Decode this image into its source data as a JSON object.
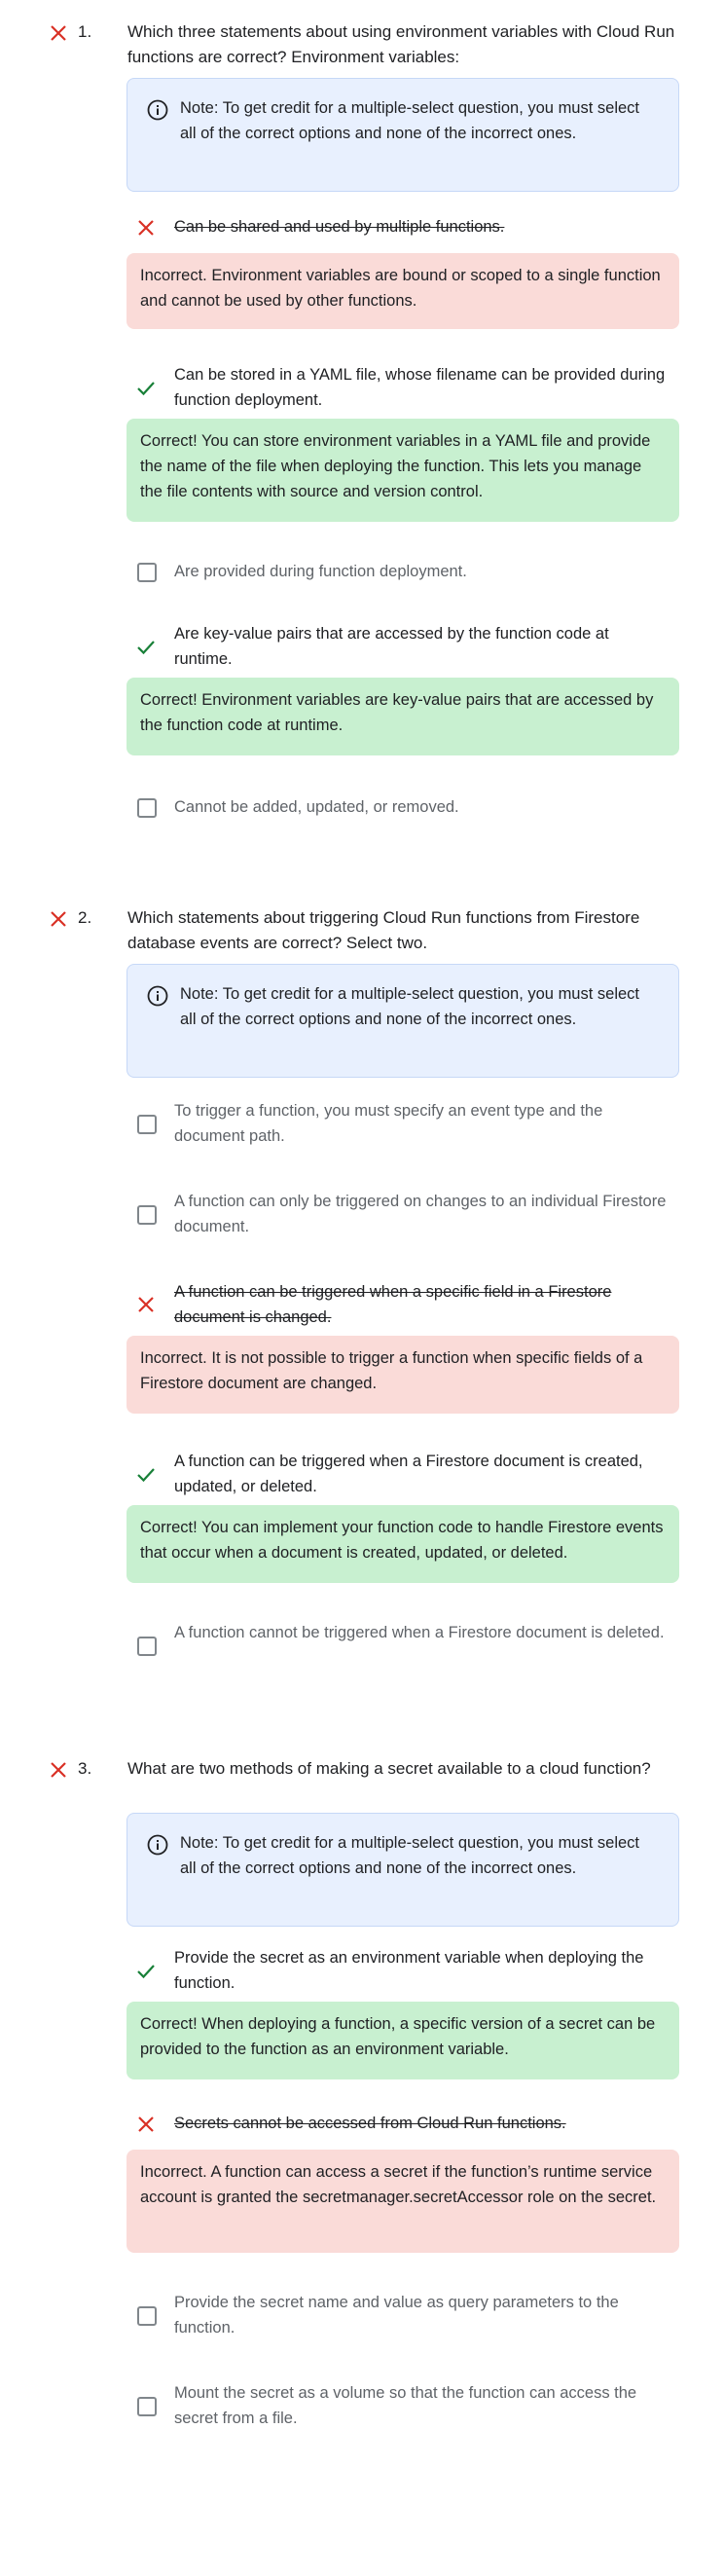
{
  "colors": {
    "incorrect": "#d93025",
    "correct": "#188038",
    "note_bg": "#e8f0fe",
    "bad_bg": "#fadbd8",
    "good_bg": "#c8f0d0"
  },
  "note_text": "Note: To get credit for a multiple-select question, you must select all of the correct options and none of the incorrect ones.",
  "questions": [
    {
      "number": "1.",
      "status_icon": "incorrect-x-icon",
      "text": "Which three statements about using environment variables with Cloud Run functions are correct? Environment variables:",
      "options": [
        {
          "text": "Can be shared and used by multiple functions.",
          "state": "incorrect",
          "feedback": "Incorrect. Environment variables are bound or scoped to a single function and cannot be used by other functions."
        },
        {
          "text": "Can be stored in a YAML file, whose filename can be provided during function deployment.",
          "state": "correct",
          "feedback": "Correct! You can store environment variables in a YAML file and provide the name of the file when deploying the function. This lets you manage the file contents with source and version control."
        },
        {
          "text": "Are provided during function deployment.",
          "state": "unselected"
        },
        {
          "text": "Are key-value pairs that are accessed by the function code at runtime.",
          "state": "correct",
          "feedback": "Correct! Environment variables are key-value pairs that are accessed by the function code at runtime."
        },
        {
          "text": "Cannot be added, updated, or removed.",
          "state": "unselected"
        }
      ]
    },
    {
      "number": "2.",
      "status_icon": "incorrect-x-icon",
      "text": "Which statements about triggering Cloud Run functions from Firestore database events are correct? Select two.",
      "options": [
        {
          "text": "To trigger a function, you must specify an event type and the document path.",
          "state": "unselected"
        },
        {
          "text": "A function can only be triggered on changes to an individual Firestore document.",
          "state": "unselected"
        },
        {
          "text": "A function can be triggered when a specific field in a Firestore document is changed.",
          "state": "incorrect",
          "feedback": "Incorrect. It is not possible to trigger a function when specific fields of a Firestore document are changed."
        },
        {
          "text": "A function can be triggered when a Firestore document is created, updated, or deleted.",
          "state": "correct",
          "feedback": "Correct! You can implement your function code to handle Firestore events that occur when a document is created, updated, or deleted."
        },
        {
          "text": "A function cannot be triggered when a Firestore document is deleted.",
          "state": "unselected"
        }
      ]
    },
    {
      "number": "3.",
      "status_icon": "incorrect-x-icon",
      "text": "What are two methods of making a secret available to a cloud function?",
      "options": [
        {
          "text": "Provide the secret as an environment variable when deploying the function.",
          "state": "correct",
          "feedback": "Correct! When deploying a function, a specific version of a secret can be provided to the function as an environment variable."
        },
        {
          "text": "Secrets cannot be accessed from Cloud Run functions.",
          "state": "incorrect",
          "feedback": "Incorrect. A function can access a secret if the function’s runtime service account is granted the secretmanager.secretAccessor role on the secret."
        },
        {
          "text": "Provide the secret name and value as query parameters to the function.",
          "state": "unselected"
        },
        {
          "text": "Mount the secret as a volume so that the function can access the secret from a file.",
          "state": "unselected"
        }
      ]
    }
  ]
}
